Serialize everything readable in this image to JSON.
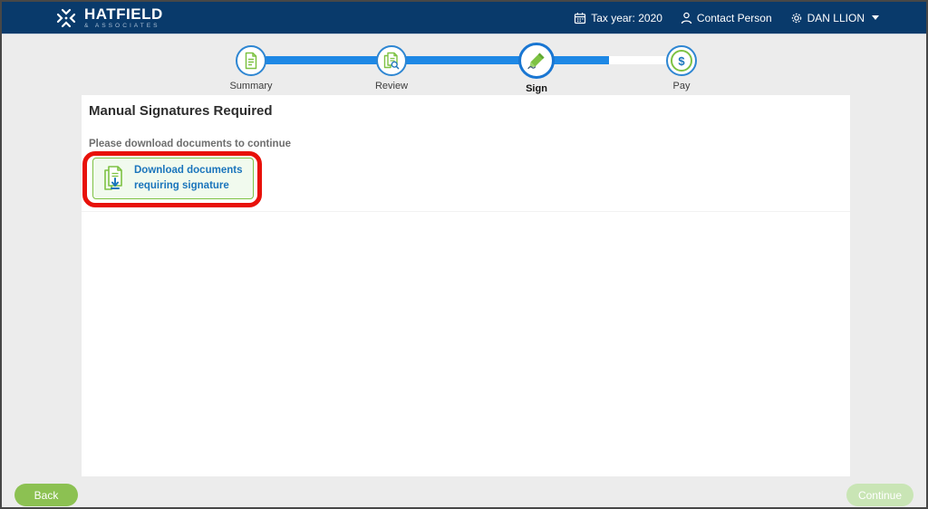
{
  "header": {
    "brand_name": "HATFIELD",
    "brand_tagline": "& ASSOCIATES",
    "tax_year_label": "Tax year: 2020",
    "contact_label": "Contact Person",
    "user_name": "DAN LLION"
  },
  "stepper": {
    "steps": [
      {
        "label": "Summary",
        "icon": "summary-document-icon",
        "state": "complete"
      },
      {
        "label": "Review",
        "icon": "review-document-search-icon",
        "state": "complete"
      },
      {
        "label": "Sign",
        "icon": "sign-pen-icon",
        "state": "active"
      },
      {
        "label": "Pay",
        "icon": "pay-dollar-icon",
        "state": "upcoming"
      }
    ],
    "dollar_sign": "$"
  },
  "main": {
    "title": "Manual Signatures Required",
    "instruction": "Please download documents to continue",
    "download_button": {
      "line1": "Download documents",
      "line2": "requiring signature"
    }
  },
  "footer": {
    "back_label": "Back",
    "continue_label": "Continue"
  },
  "colors": {
    "header_bg": "#093A6B",
    "progress_blue": "#1E88E5",
    "step_border_blue": "#2E86D2",
    "accent_green": "#7DC243",
    "link_blue": "#1B75BC",
    "download_button_bg": "#F1FAEE",
    "back_button_green": "#8CC152",
    "continue_disabled_green": "#C9E5B5",
    "annotation_red": "#E8110A"
  }
}
